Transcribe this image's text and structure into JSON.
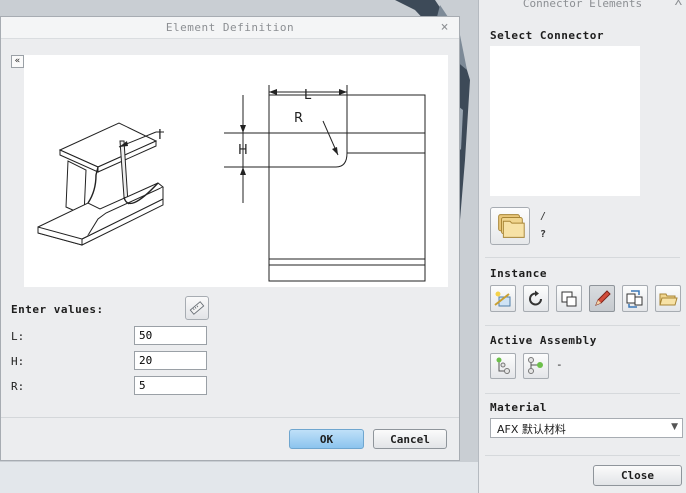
{
  "dialog": {
    "title": "Element Definition",
    "close_glyph": "×",
    "collapse_glyph": "«",
    "figure_labels": {
      "i": "I",
      "l": "L",
      "r": "R",
      "h": "H"
    },
    "enter_values_label": "Enter values:",
    "fields": [
      {
        "label": "L:",
        "value": "50"
      },
      {
        "label": "H:",
        "value": "20"
      },
      {
        "label": "R:",
        "value": "5"
      }
    ],
    "ok_label": "OK",
    "cancel_label": "Cancel"
  },
  "panel": {
    "title": "Connector Elements",
    "close_glyph": "X",
    "select_connector_label": "Select Connector",
    "select_hint_slash": "/",
    "select_hint_question": "?",
    "instance_label": "Instance",
    "instance_tools": [
      "new-instance-icon",
      "refresh-icon",
      "copy-instance-icon",
      "edit-pencil-icon",
      "replace-icon",
      "open-folder-icon"
    ],
    "active_assembly_label": "Active Assembly",
    "active_assembly_value": "-",
    "material_label": "Material",
    "material_value": "AFX 默认材料",
    "close_label": "Close"
  },
  "colors": {
    "ok_button": "#8cc4ee",
    "dialog_bg": "#ecedef",
    "title_text": "#8c8f93"
  }
}
